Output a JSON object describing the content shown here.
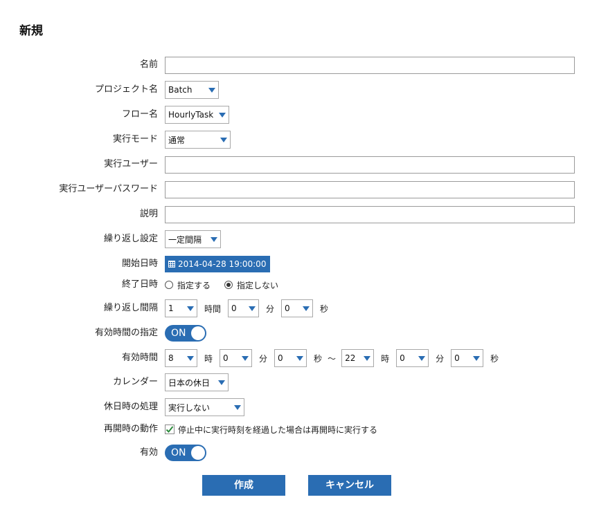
{
  "page": {
    "title": "新規"
  },
  "form": {
    "name": {
      "label": "名前",
      "value": ""
    },
    "project": {
      "label": "プロジェクト名",
      "value": "Batch"
    },
    "flow": {
      "label": "フロー名",
      "value": "HourlyTask"
    },
    "mode": {
      "label": "実行モード",
      "value": "通常"
    },
    "user": {
      "label": "実行ユーザー",
      "value": ""
    },
    "password": {
      "label": "実行ユーザーパスワード",
      "value": ""
    },
    "description": {
      "label": "説明",
      "value": ""
    },
    "repeat": {
      "label": "繰り返し設定",
      "value": "一定間隔"
    },
    "start": {
      "label": "開始日時",
      "value": "2014-04-28 19:00:00"
    },
    "end": {
      "label": "終了日時",
      "option_specify": "指定する",
      "option_none": "指定しない",
      "selected": "指定しない"
    },
    "interval": {
      "label": "繰り返し間隔",
      "hours": "1",
      "hour_unit": "時間",
      "minutes": "0",
      "minute_unit": "分",
      "seconds": "0",
      "second_unit": "秒"
    },
    "validity_toggle": {
      "label": "有効時間の指定",
      "state": "ON"
    },
    "validity": {
      "label": "有効時間",
      "from_h": "8",
      "from_m": "0",
      "from_s": "0",
      "to_h": "22",
      "to_m": "0",
      "to_s": "0",
      "h_unit": "時",
      "m_unit": "分",
      "s_unit": "秒",
      "sep": "〜"
    },
    "calendar": {
      "label": "カレンダー",
      "value": "日本の休日"
    },
    "holiday": {
      "label": "休日時の処理",
      "value": "実行しない"
    },
    "resume": {
      "label": "再開時の動作",
      "checkbox_label": "停止中に実行時刻を経過した場合は再開時に実行する",
      "checked": true
    },
    "enabled": {
      "label": "有効",
      "state": "ON"
    }
  },
  "buttons": {
    "create": "作成",
    "cancel": "キャンセル"
  },
  "colors": {
    "accent": "#2a6db3"
  }
}
